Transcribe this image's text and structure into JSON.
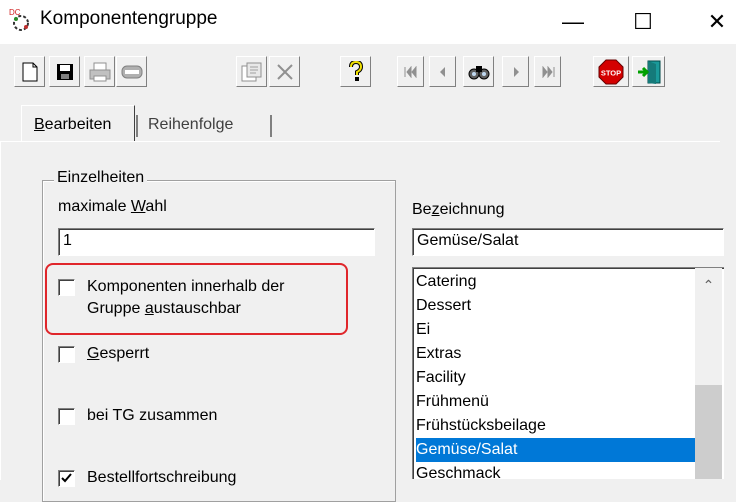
{
  "window": {
    "title": "Komponentengruppe",
    "minimize_glyph": "—",
    "maximize_glyph": "☐",
    "close_glyph": "✕"
  },
  "toolbar": {
    "buttons": [
      {
        "name": "new-document-icon"
      },
      {
        "name": "save-icon"
      },
      {
        "name": "print-icon"
      },
      {
        "name": "preview-icon"
      },
      {
        "name": "properties-icon"
      },
      {
        "name": "delete-icon"
      },
      {
        "name": "help-icon"
      },
      {
        "name": "first-record-icon"
      },
      {
        "name": "previous-record-icon"
      },
      {
        "name": "find-icon"
      },
      {
        "name": "next-record-icon"
      },
      {
        "name": "last-record-icon"
      },
      {
        "name": "stop-icon"
      },
      {
        "name": "exit-icon"
      }
    ],
    "stop_text": "STOP"
  },
  "tabs": [
    {
      "label_first": "B",
      "label_rest": "earbeiten",
      "active": true
    },
    {
      "label": "Reihenfolge",
      "active": false
    }
  ],
  "details": {
    "group_title": "Einzelheiten",
    "max_choice_label_pre": "maximale ",
    "max_choice_label_ul": "W",
    "max_choice_label_post": "ahl",
    "max_choice_value": "1",
    "description_label_pre": "Be",
    "description_label_ul": "z",
    "description_label_post": "eichnung",
    "description_value": "Gemüse/Salat",
    "checkboxes": [
      {
        "line1": "Komponenten innerhalb der",
        "line2_pre": "Gruppe ",
        "line2_ul": "a",
        "line2_post": "ustauschbar",
        "checked": false
      },
      {
        "label_ul": "G",
        "label_rest": "esperrt",
        "checked": false
      },
      {
        "label": "bei TG zusammen",
        "checked": false
      },
      {
        "label": "Bestellfortschreibung",
        "checked": true
      }
    ]
  },
  "list": {
    "items": [
      "Catering",
      "Dessert",
      "Ei",
      "Extras",
      "Facility",
      "Frühmenü",
      "Frühstücksbeilage",
      "Gemüse/Salat",
      "Geschmack"
    ],
    "selected": "Gemüse/Salat",
    "scroll_up_glyph": "⌃"
  },
  "colors": {
    "highlight": "#e0262b",
    "selection": "#0078d7"
  }
}
